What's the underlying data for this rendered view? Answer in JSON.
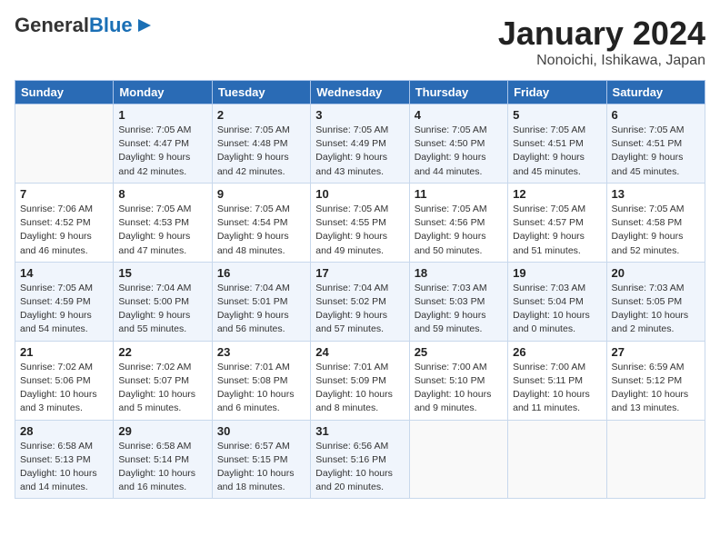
{
  "header": {
    "logo_line1": "General",
    "logo_line2": "Blue",
    "title": "January 2024",
    "subtitle": "Nonoichi, Ishikawa, Japan"
  },
  "days_of_week": [
    "Sunday",
    "Monday",
    "Tuesday",
    "Wednesday",
    "Thursday",
    "Friday",
    "Saturday"
  ],
  "weeks": [
    [
      {
        "day": "",
        "info": ""
      },
      {
        "day": "1",
        "info": "Sunrise: 7:05 AM\nSunset: 4:47 PM\nDaylight: 9 hours\nand 42 minutes."
      },
      {
        "day": "2",
        "info": "Sunrise: 7:05 AM\nSunset: 4:48 PM\nDaylight: 9 hours\nand 42 minutes."
      },
      {
        "day": "3",
        "info": "Sunrise: 7:05 AM\nSunset: 4:49 PM\nDaylight: 9 hours\nand 43 minutes."
      },
      {
        "day": "4",
        "info": "Sunrise: 7:05 AM\nSunset: 4:50 PM\nDaylight: 9 hours\nand 44 minutes."
      },
      {
        "day": "5",
        "info": "Sunrise: 7:05 AM\nSunset: 4:51 PM\nDaylight: 9 hours\nand 45 minutes."
      },
      {
        "day": "6",
        "info": "Sunrise: 7:05 AM\nSunset: 4:51 PM\nDaylight: 9 hours\nand 45 minutes."
      }
    ],
    [
      {
        "day": "7",
        "info": "Sunrise: 7:06 AM\nSunset: 4:52 PM\nDaylight: 9 hours\nand 46 minutes."
      },
      {
        "day": "8",
        "info": "Sunrise: 7:05 AM\nSunset: 4:53 PM\nDaylight: 9 hours\nand 47 minutes."
      },
      {
        "day": "9",
        "info": "Sunrise: 7:05 AM\nSunset: 4:54 PM\nDaylight: 9 hours\nand 48 minutes."
      },
      {
        "day": "10",
        "info": "Sunrise: 7:05 AM\nSunset: 4:55 PM\nDaylight: 9 hours\nand 49 minutes."
      },
      {
        "day": "11",
        "info": "Sunrise: 7:05 AM\nSunset: 4:56 PM\nDaylight: 9 hours\nand 50 minutes."
      },
      {
        "day": "12",
        "info": "Sunrise: 7:05 AM\nSunset: 4:57 PM\nDaylight: 9 hours\nand 51 minutes."
      },
      {
        "day": "13",
        "info": "Sunrise: 7:05 AM\nSunset: 4:58 PM\nDaylight: 9 hours\nand 52 minutes."
      }
    ],
    [
      {
        "day": "14",
        "info": "Sunrise: 7:05 AM\nSunset: 4:59 PM\nDaylight: 9 hours\nand 54 minutes."
      },
      {
        "day": "15",
        "info": "Sunrise: 7:04 AM\nSunset: 5:00 PM\nDaylight: 9 hours\nand 55 minutes."
      },
      {
        "day": "16",
        "info": "Sunrise: 7:04 AM\nSunset: 5:01 PM\nDaylight: 9 hours\nand 56 minutes."
      },
      {
        "day": "17",
        "info": "Sunrise: 7:04 AM\nSunset: 5:02 PM\nDaylight: 9 hours\nand 57 minutes."
      },
      {
        "day": "18",
        "info": "Sunrise: 7:03 AM\nSunset: 5:03 PM\nDaylight: 9 hours\nand 59 minutes."
      },
      {
        "day": "19",
        "info": "Sunrise: 7:03 AM\nSunset: 5:04 PM\nDaylight: 10 hours\nand 0 minutes."
      },
      {
        "day": "20",
        "info": "Sunrise: 7:03 AM\nSunset: 5:05 PM\nDaylight: 10 hours\nand 2 minutes."
      }
    ],
    [
      {
        "day": "21",
        "info": "Sunrise: 7:02 AM\nSunset: 5:06 PM\nDaylight: 10 hours\nand 3 minutes."
      },
      {
        "day": "22",
        "info": "Sunrise: 7:02 AM\nSunset: 5:07 PM\nDaylight: 10 hours\nand 5 minutes."
      },
      {
        "day": "23",
        "info": "Sunrise: 7:01 AM\nSunset: 5:08 PM\nDaylight: 10 hours\nand 6 minutes."
      },
      {
        "day": "24",
        "info": "Sunrise: 7:01 AM\nSunset: 5:09 PM\nDaylight: 10 hours\nand 8 minutes."
      },
      {
        "day": "25",
        "info": "Sunrise: 7:00 AM\nSunset: 5:10 PM\nDaylight: 10 hours\nand 9 minutes."
      },
      {
        "day": "26",
        "info": "Sunrise: 7:00 AM\nSunset: 5:11 PM\nDaylight: 10 hours\nand 11 minutes."
      },
      {
        "day": "27",
        "info": "Sunrise: 6:59 AM\nSunset: 5:12 PM\nDaylight: 10 hours\nand 13 minutes."
      }
    ],
    [
      {
        "day": "28",
        "info": "Sunrise: 6:58 AM\nSunset: 5:13 PM\nDaylight: 10 hours\nand 14 minutes."
      },
      {
        "day": "29",
        "info": "Sunrise: 6:58 AM\nSunset: 5:14 PM\nDaylight: 10 hours\nand 16 minutes."
      },
      {
        "day": "30",
        "info": "Sunrise: 6:57 AM\nSunset: 5:15 PM\nDaylight: 10 hours\nand 18 minutes."
      },
      {
        "day": "31",
        "info": "Sunrise: 6:56 AM\nSunset: 5:16 PM\nDaylight: 10 hours\nand 20 minutes."
      },
      {
        "day": "",
        "info": ""
      },
      {
        "day": "",
        "info": ""
      },
      {
        "day": "",
        "info": ""
      }
    ]
  ]
}
